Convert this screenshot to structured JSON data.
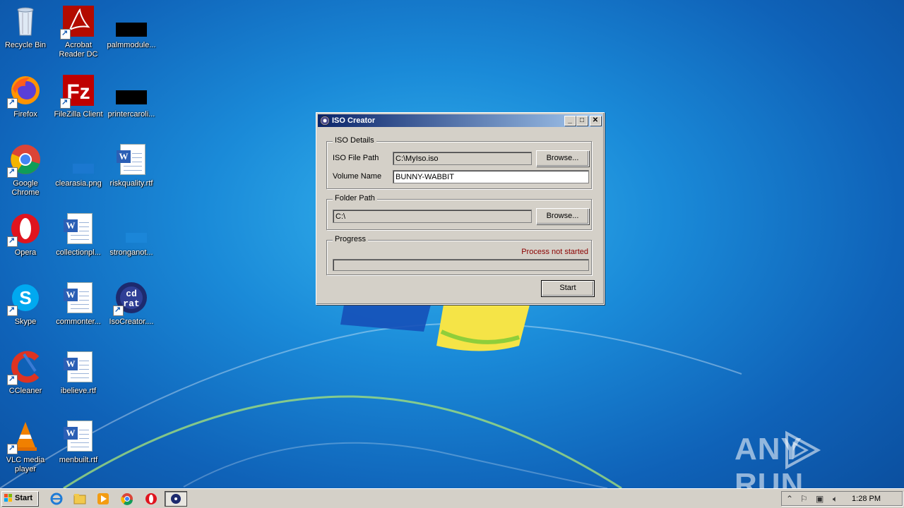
{
  "desktop": {
    "icons": [
      {
        "label": "Recycle Bin"
      },
      {
        "label": "Acrobat Reader DC"
      },
      {
        "label": "palmmodule..."
      },
      {
        "label": "Firefox"
      },
      {
        "label": "FileZilla Client"
      },
      {
        "label": "printercaroli..."
      },
      {
        "label": "Google Chrome"
      },
      {
        "label": "clearasia.png"
      },
      {
        "label": "riskquality.rtf"
      },
      {
        "label": "Opera"
      },
      {
        "label": "collectionpl..."
      },
      {
        "label": "stronganot..."
      },
      {
        "label": "Skype"
      },
      {
        "label": "commonter..."
      },
      {
        "label": "IsoCreator...."
      },
      {
        "label": "CCleaner"
      },
      {
        "label": "ibelieve.rtf"
      },
      {
        "label": "VLC media player"
      },
      {
        "label": "menbuilt.rtf"
      }
    ]
  },
  "dialog": {
    "title": "ISO Creator",
    "iso_group": "ISO Details",
    "iso_path_label": "ISO File Path",
    "iso_path_value": "C:\\MyIso.iso",
    "browse_label": "Browse...",
    "volume_label": "Volume Name",
    "volume_value": "BUNNY-WABBIT",
    "folder_group": "Folder Path",
    "folder_value": "C:\\",
    "folder_browse_label": "Browse...",
    "progress_group": "Progress",
    "status_text": "Process not started",
    "progress_value": 0,
    "start_label": "Start"
  },
  "taskbar": {
    "start_label": "Start",
    "clock": "1:28 PM"
  },
  "watermark": {
    "text_left": "ANY",
    "text_right": "RUN"
  }
}
